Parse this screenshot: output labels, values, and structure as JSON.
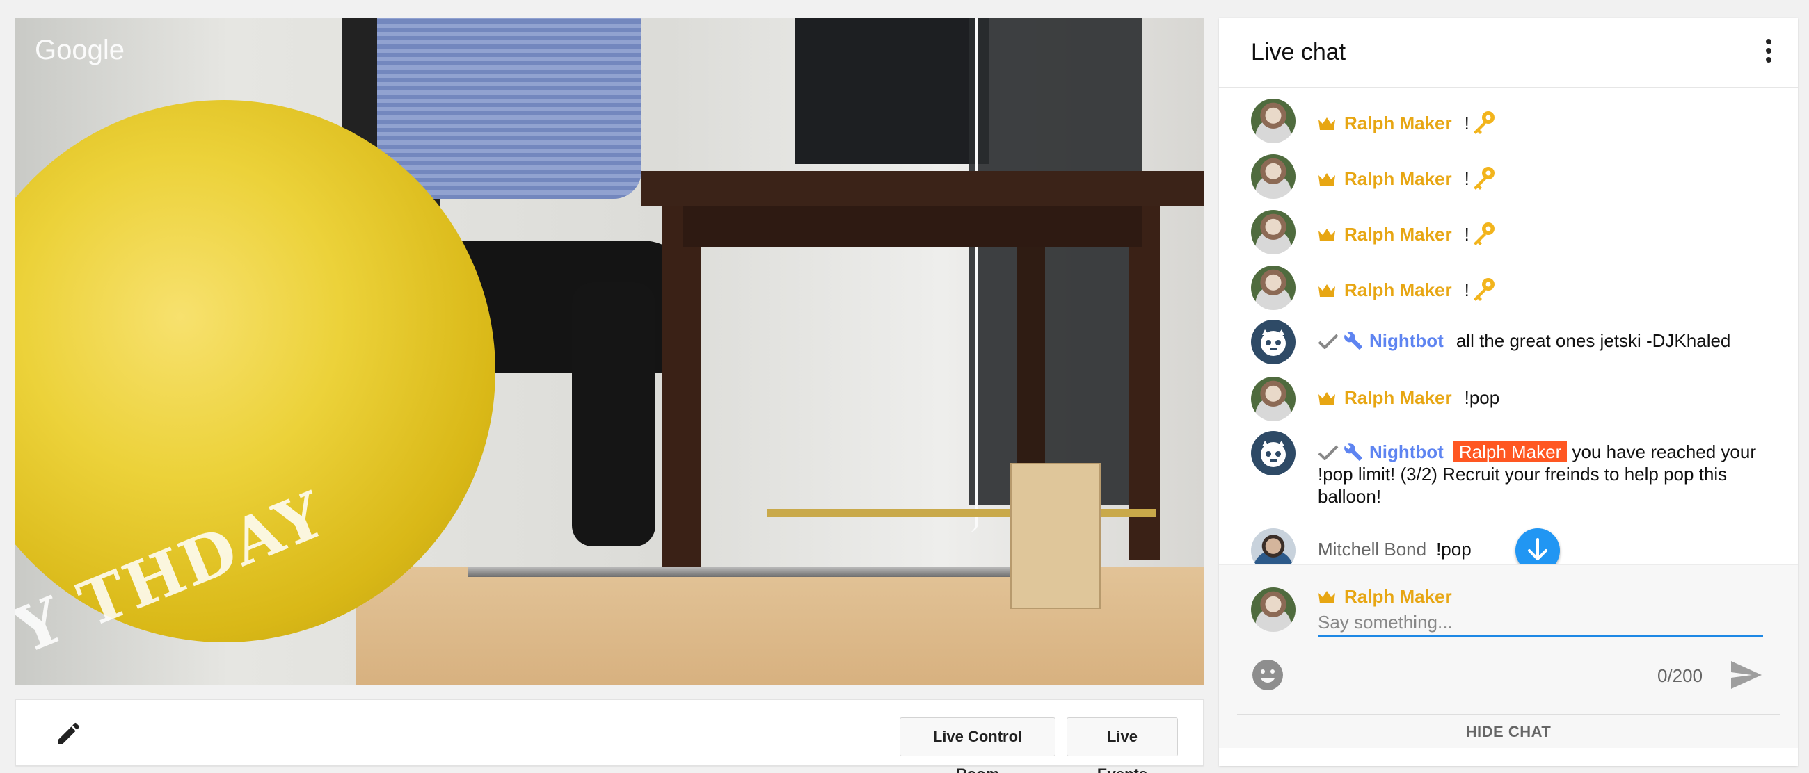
{
  "video": {
    "brand": "Google"
  },
  "toolbar": {
    "control_room": "Live Control Room",
    "events": "Live Events"
  },
  "chat": {
    "title": "Live chat",
    "messages": [
      {
        "author": "Ralph Maker",
        "role": "owner",
        "text": "!"
      },
      {
        "author": "Ralph Maker",
        "role": "owner",
        "text": "!"
      },
      {
        "author": "Ralph Maker",
        "role": "owner",
        "text": "!"
      },
      {
        "author": "Ralph Maker",
        "role": "owner",
        "text": "!"
      },
      {
        "author": "Nightbot",
        "role": "moderator",
        "text": "all the great ones jetski -DJKhaled"
      },
      {
        "author": "Ralph Maker",
        "role": "owner",
        "text": "!pop"
      },
      {
        "author": "Nightbot",
        "role": "moderator",
        "mention": "Ralph Maker",
        "text": "you have reached your !pop limit! (3/2) Recruit your freinds to help pop this balloon!"
      },
      {
        "author": "Mitchell Bond",
        "role": "viewer",
        "text": "!pop"
      }
    ],
    "compose": {
      "author": "Ralph Maker",
      "placeholder": "Say something...",
      "counter": "0/200",
      "hide_label": "HIDE CHAT"
    }
  },
  "colors": {
    "owner": "#e7a613",
    "moderator": "#5e84f1",
    "mention_bg": "#ff5722",
    "accent": "#1e88e5"
  },
  "icons": [
    "crown-icon",
    "key-icon",
    "check-icon",
    "wrench-icon",
    "edit-icon",
    "more-vert-icon",
    "arrow-down-icon",
    "emoji-icon",
    "send-icon"
  ]
}
